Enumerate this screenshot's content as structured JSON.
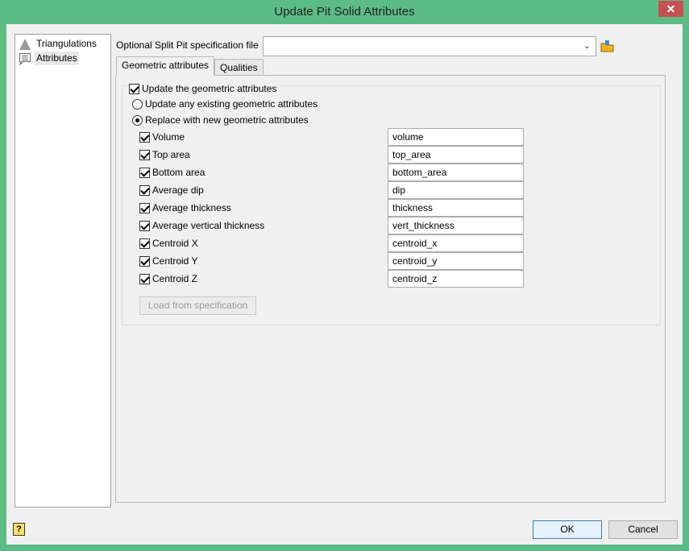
{
  "window": {
    "title": "Update Pit Solid Attributes",
    "close": "✕"
  },
  "tree": [
    {
      "label": "Triangulations"
    },
    {
      "label": "Attributes"
    }
  ],
  "spec_file": {
    "label": "Optional Split Pit specification file",
    "value": ""
  },
  "tabs": [
    {
      "label": "Geometric attributes"
    },
    {
      "label": "Qualities"
    }
  ],
  "geometric": {
    "update_label": "Update the geometric attributes",
    "update_checked": true,
    "mode_options": [
      {
        "label": "Update any existing geometric attributes",
        "selected": false
      },
      {
        "label": "Replace with new geometric attributes",
        "selected": true
      }
    ],
    "attributes": [
      {
        "label": "Volume",
        "value": "volume",
        "checked": true
      },
      {
        "label": "Top area",
        "value": "top_area",
        "checked": true
      },
      {
        "label": "Bottom area",
        "value": "bottom_area",
        "checked": true
      },
      {
        "label": "Average dip",
        "value": "dip",
        "checked": true
      },
      {
        "label": "Average thickness",
        "value": "thickness",
        "checked": true
      },
      {
        "label": "Average vertical thickness",
        "value": "vert_thickness",
        "checked": true
      },
      {
        "label": "Centroid X",
        "value": "centroid_x",
        "checked": true
      },
      {
        "label": "Centroid Y",
        "value": "centroid_y",
        "checked": true
      },
      {
        "label": "Centroid Z",
        "value": "centroid_z",
        "checked": true
      }
    ],
    "load_button": "Load from specification"
  },
  "footer": {
    "help": "?",
    "ok": "OK",
    "cancel": "Cancel"
  }
}
